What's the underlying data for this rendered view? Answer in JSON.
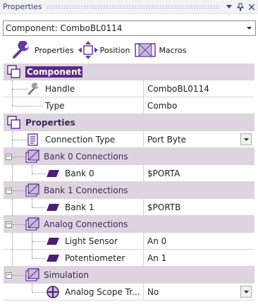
{
  "panel": {
    "title": "Properties",
    "buttons": {
      "dropdown": "▾",
      "pin": "📌",
      "close": "✕"
    }
  },
  "component_selector": {
    "value": "Component: ComboBL0114"
  },
  "tabs": [
    {
      "label": "Properties",
      "icon": "wrench-icon"
    },
    {
      "label": "Position",
      "icon": "move-arrows-icon"
    },
    {
      "label": "Macros",
      "icon": "macro-icon"
    }
  ],
  "grid": {
    "component_header": "Component",
    "handle": {
      "name": "Handle",
      "value": "ComboBL0114"
    },
    "type": {
      "name": "Type",
      "value": "Combo"
    },
    "properties_header": "Properties",
    "connection_type": {
      "name": "Connection Type",
      "value": "Port Byte"
    },
    "bank0_section": "Bank 0 Connections",
    "bank0": {
      "name": "Bank 0",
      "value": "$PORTA"
    },
    "bank1_section": "Bank 1 Connections",
    "bank1": {
      "name": "Bank 1",
      "value": "$PORTB"
    },
    "analog_section": "Analog Connections",
    "light_sensor": {
      "name": "Light Sensor",
      "value": "An 0"
    },
    "potentiometer": {
      "name": "Potentiometer",
      "value": "An 1"
    },
    "simulation_section": "Simulation",
    "analog_scope": {
      "name": "Analog Scope Tr...",
      "value": "No"
    }
  },
  "colors": {
    "header_bg": "#ddd4e0",
    "accent_purple": "#5b2a86",
    "title_text": "#3b3b6b"
  }
}
